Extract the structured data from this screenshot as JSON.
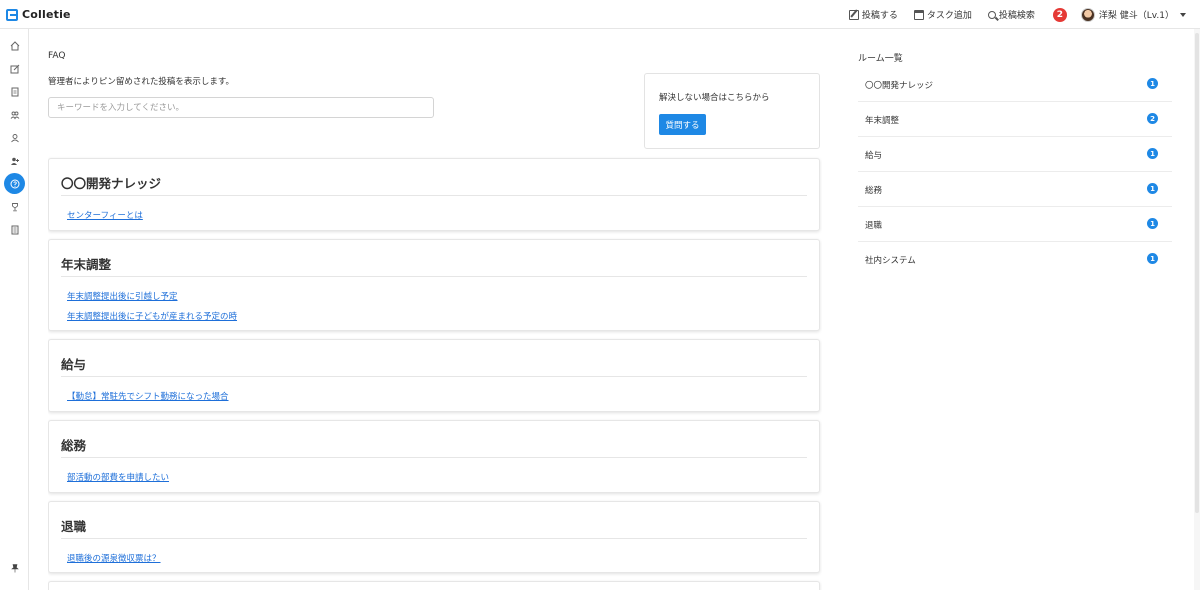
{
  "app": {
    "name": "Colletie"
  },
  "header": {
    "post_label": "投稿する",
    "task_label": "タスク追加",
    "search_label": "投稿検索",
    "notification_count": "2",
    "user_name": "洋梨 健斗（Lv.1）"
  },
  "sidebar": {
    "items": [
      "home-icon",
      "edit-icon",
      "document-icon",
      "group-icon",
      "user-icon",
      "users-icon",
      "help-icon",
      "trophy-icon",
      "book-icon",
      "pin-icon"
    ],
    "active_item": "help-icon"
  },
  "faq": {
    "title": "FAQ",
    "description": "管理者によりピン留めされた投稿を表示します。",
    "search_placeholder": "キーワードを入力してください。",
    "help_text": "解決しない場合はこちらから",
    "help_button": "質問する",
    "sections": [
      {
        "title": "〇〇開発ナレッジ",
        "links": [
          "センターフィーとは"
        ]
      },
      {
        "title": "年末調整",
        "links": [
          "年末調整提出後に引越し予定",
          "年末調整提出後に子どもが産まれる予定の時"
        ]
      },
      {
        "title": "給与",
        "links": [
          "【勤怠】常駐先でシフト勤務になった場合"
        ]
      },
      {
        "title": "総務",
        "links": [
          "部活動の部費を申請したい"
        ]
      },
      {
        "title": "退職",
        "links": [
          "退職後の源泉徴収票は？"
        ]
      }
    ]
  },
  "rooms": {
    "title": "ルーム一覧",
    "items": [
      {
        "name": "〇〇開発ナレッジ",
        "count": "1"
      },
      {
        "name": "年末調整",
        "count": "2"
      },
      {
        "name": "給与",
        "count": "1"
      },
      {
        "name": "総務",
        "count": "1"
      },
      {
        "name": "退職",
        "count": "1"
      },
      {
        "name": "社内システム",
        "count": "1"
      }
    ]
  },
  "colors": {
    "accent": "#1e88e5",
    "notification": "#e53935",
    "link": "#1e6fd9"
  }
}
